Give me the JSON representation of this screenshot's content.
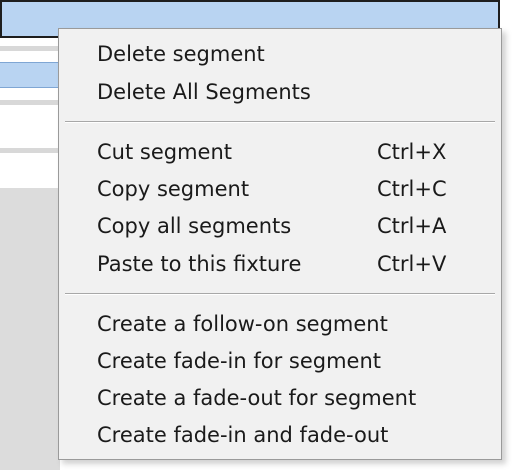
{
  "context_menu": {
    "items": [
      {
        "label": "Delete segment",
        "shortcut": ""
      },
      {
        "label": "Delete All Segments",
        "shortcut": ""
      },
      {
        "label": "Cut segment",
        "shortcut": "Ctrl+X"
      },
      {
        "label": "Copy segment",
        "shortcut": "Ctrl+C"
      },
      {
        "label": "Copy all segments",
        "shortcut": "Ctrl+A"
      },
      {
        "label": "Paste to this fixture",
        "shortcut": "Ctrl+V"
      },
      {
        "label": "Create a follow-on segment",
        "shortcut": ""
      },
      {
        "label": "Create fade-in for segment",
        "shortcut": ""
      },
      {
        "label": "Create a fade-out for segment",
        "shortcut": ""
      },
      {
        "label": "Create fade-in and fade-out",
        "shortcut": ""
      }
    ]
  },
  "colors": {
    "titlebar": "#b9d4f2",
    "menu_background": "#f1f1f1",
    "menu_text": "#1a1a1a"
  }
}
